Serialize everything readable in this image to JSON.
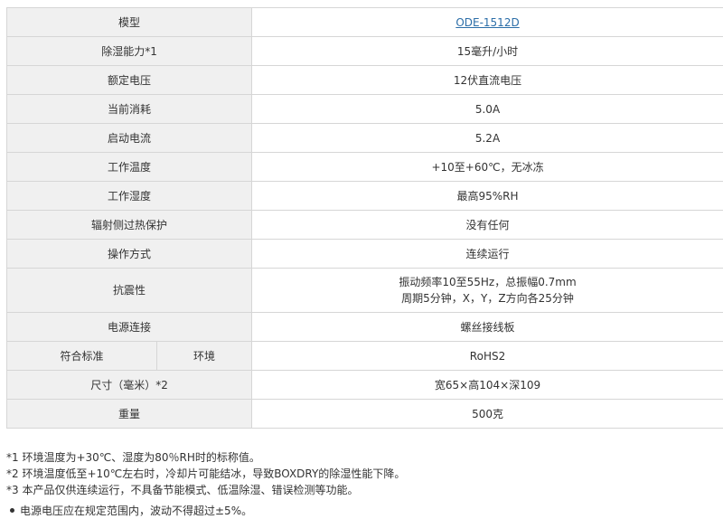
{
  "table": {
    "rows": [
      {
        "label": "模型",
        "value": "ODE-1512D",
        "is_link": true
      },
      {
        "label": "除湿能力*1",
        "value": "15毫升/小时"
      },
      {
        "label": "额定电压",
        "value": "12伏直流电压"
      },
      {
        "label": "当前消耗",
        "value": "5.0A"
      },
      {
        "label": "启动电流",
        "value": "5.2A"
      },
      {
        "label": "工作温度",
        "value": "+10至+60℃，无冰冻"
      },
      {
        "label": "工作湿度",
        "value": "最高95%RH"
      },
      {
        "label": "辐射侧过热保护",
        "value": "没有任何"
      },
      {
        "label": "操作方式",
        "value": "连续运行"
      },
      {
        "label": "抗震性",
        "value_line1": "振动频率10至55Hz，总振幅0.7mm",
        "value_line2": "周期5分钟，X，Y，Z方向各25分钟"
      },
      {
        "label": "电源连接",
        "value": "螺丝接线板"
      },
      {
        "label": "符合标准",
        "sublabel": "环境",
        "value": "RoHS2"
      },
      {
        "label": "尺寸（毫米）*2",
        "value": "宽65×高104×深109"
      },
      {
        "label": "重量",
        "value": "500克"
      }
    ]
  },
  "notes": [
    "*1 环境温度为+30℃、湿度为80％RH时的标称值。",
    "*2 环境温度低至+10℃左右时，冷却片可能结冰，导致BOXDRY的除湿性能下降。",
    "*3 本产品仅供连续运行，不具备节能模式、低温除湿、错误检测等功能。"
  ],
  "bullet_note": "电源电压应在规定范围内，波动不得超过±5%。",
  "colors": {
    "label_bg": "#f0f0f0",
    "border": "#d6d6d6",
    "link": "#2c6ea8",
    "text": "#333333"
  }
}
